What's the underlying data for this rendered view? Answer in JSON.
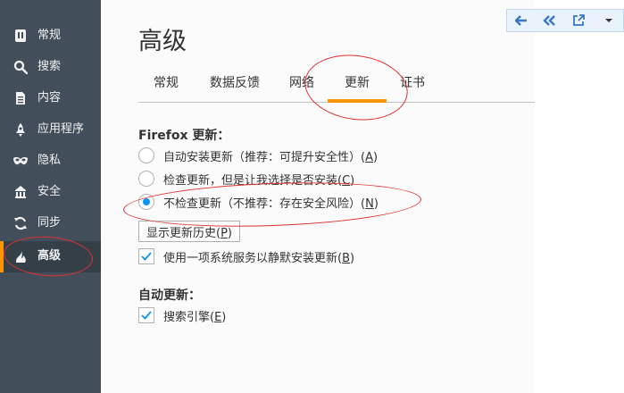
{
  "sidebar": {
    "items": [
      {
        "label": "常规",
        "icon": "general-icon"
      },
      {
        "label": "搜索",
        "icon": "search-icon"
      },
      {
        "label": "内容",
        "icon": "content-icon"
      },
      {
        "label": "应用程序",
        "icon": "applications-icon"
      },
      {
        "label": "隐私",
        "icon": "privacy-mask-icon"
      },
      {
        "label": "安全",
        "icon": "security-icon"
      },
      {
        "label": "同步",
        "icon": "sync-icon"
      },
      {
        "label": "高级",
        "icon": "advanced-icon",
        "active": true
      }
    ]
  },
  "page": {
    "title": "高级"
  },
  "tabs": [
    {
      "label": "常规"
    },
    {
      "label": "数据反馈"
    },
    {
      "label": "网络"
    },
    {
      "label": "更新",
      "selected": true
    },
    {
      "label": "证书"
    }
  ],
  "update": {
    "section_title": "Firefox 更新：",
    "options": [
      {
        "text": "自动安装更新（推荐：可提升安全性）(",
        "key": "A",
        "end": ")",
        "checked": false
      },
      {
        "text": "检查更新，但是让我选择是否安装(",
        "key": "C",
        "end": ")",
        "checked": false
      },
      {
        "text": "不检查更新（不推荐：存在安全风险）(",
        "key": "N",
        "end": ")",
        "checked": true
      }
    ],
    "history_button": {
      "text": "显示更新历史(",
      "key": "P",
      "end": ")"
    },
    "service_checkbox": {
      "text": "使用一项系统服务以静默安装更新(",
      "key": "B",
      "end": ")",
      "checked": true
    }
  },
  "auto_update": {
    "section_title": "自动更新：",
    "search_checkbox": {
      "text": "搜索引擎(",
      "key": "E",
      "end": ")",
      "checked": true
    }
  },
  "toolbar": {
    "buttons": [
      "back-arrow-icon",
      "double-back-arrow-icon",
      "open-external-icon",
      "dropdown-icon"
    ]
  },
  "colors": {
    "sidebar_bg": "#424f5a",
    "accent": "#ff9500",
    "radio_checked": "#0996f8",
    "annotation": "#e03030"
  }
}
